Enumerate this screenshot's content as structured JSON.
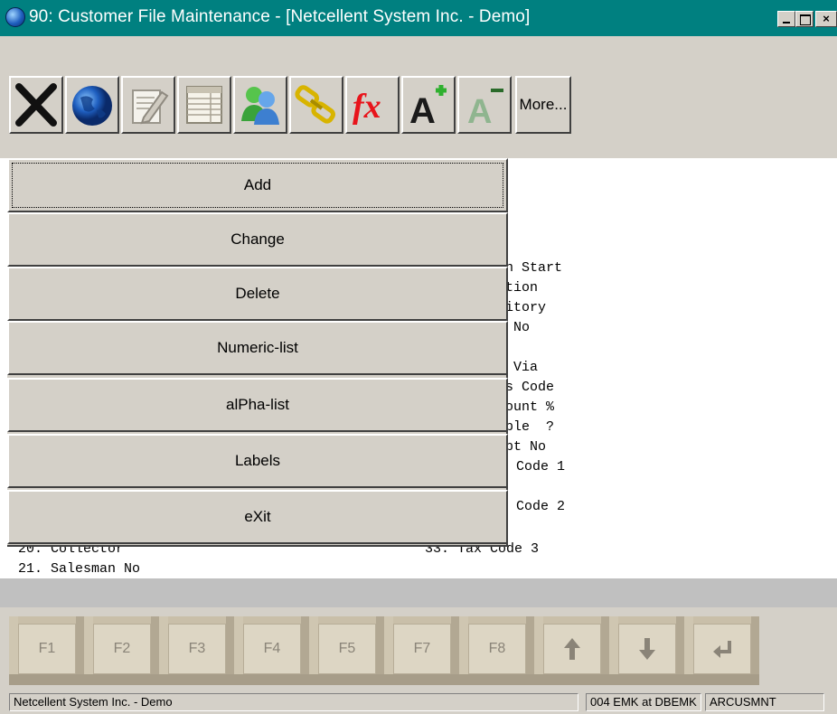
{
  "window": {
    "title": "90: Customer File Maintenance - [Netcellent System Inc. - Demo]",
    "controls": [
      "minimize",
      "maximize",
      "close"
    ]
  },
  "toolbar": {
    "buttons": [
      {
        "icon": "close-x-icon"
      },
      {
        "icon": "globe-icon"
      },
      {
        "icon": "edit-note-icon"
      },
      {
        "icon": "spreadsheet-icon"
      },
      {
        "icon": "users-icon"
      },
      {
        "icon": "chain-link-icon"
      },
      {
        "icon": "function-fx-icon"
      },
      {
        "icon": "font-increase-icon"
      },
      {
        "icon": "font-decrease-icon"
      }
    ],
    "more_label": "More..."
  },
  "menu": {
    "items": [
      {
        "label": "Add"
      },
      {
        "label": "Change"
      },
      {
        "label": "Delete"
      },
      {
        "label": "Numeric-list"
      },
      {
        "label": "alPha-list"
      },
      {
        "label": "Labels"
      },
      {
        "label": "eXit"
      }
    ]
  },
  "fields_visible": {
    "right_column": [
      "mn Start",
      "ation",
      "ritory",
      "t No",
      "p Via",
      "ms Code",
      "count %",
      "able  ?",
      "mpt No",
      " Code 1",
      " Code 2"
    ],
    "row_20_left": "20. Collector",
    "row_33_right": "33. Tax Code 3",
    "row_21_left": "21. Salesman No"
  },
  "fkeys": [
    {
      "label": "F1"
    },
    {
      "label": "F2"
    },
    {
      "label": "F3"
    },
    {
      "label": "F4"
    },
    {
      "label": "F5"
    },
    {
      "label": "F7"
    },
    {
      "label": "F8"
    },
    {
      "icon": "arrow-up-icon"
    },
    {
      "icon": "arrow-down-icon"
    },
    {
      "icon": "enter-icon"
    }
  ],
  "statusbar": {
    "company": "Netcellent System Inc. - Demo",
    "user": "004 EMK at DBEMK",
    "program": "ARCUSMNT"
  },
  "colors": {
    "titlebar": "#008080",
    "face": "#d4d0c8",
    "content_bg": "#ffffff",
    "fx_red": "#e8141b",
    "font_plus_green": "#2fb02f"
  }
}
